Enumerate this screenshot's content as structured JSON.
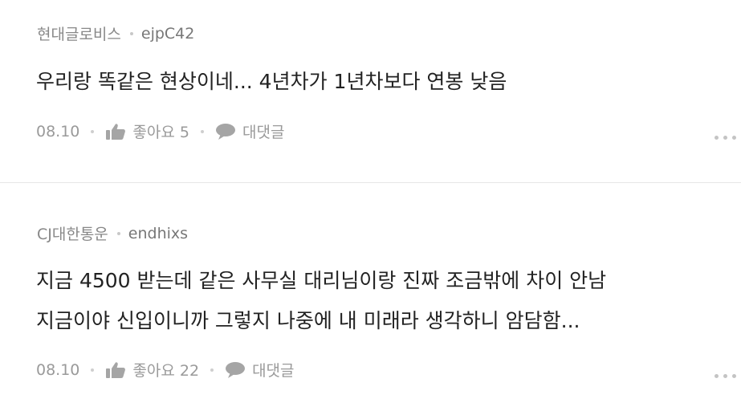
{
  "comments": [
    {
      "company": "현대글로비스",
      "user": "ejpC42",
      "lines": [
        "우리랑 똑같은 현상이네... 4년차가 1년차보다 연봉 낮음"
      ],
      "date": "08.10",
      "like_label": "좋아요 5",
      "reply_label": "대댓글"
    },
    {
      "company": "CJ대한통운",
      "user": "endhixs",
      "lines": [
        "지금 4500 받는데 같은 사무실 대리님이랑 진짜 조금밖에 차이 안남",
        "지금이야 신입이니까 그렇지 나중에 내 미래라 생각하니 암담함..."
      ],
      "date": "08.10",
      "like_label": "좋아요 22",
      "reply_label": "대댓글"
    }
  ],
  "icons": {
    "like": "thumbs-up-icon",
    "reply": "speech-bubble-icon",
    "more": "more-dots-icon"
  },
  "colors": {
    "text": "#222222",
    "meta": "#888888",
    "icon": "#a5a5a5",
    "divider": "#e6e6e6"
  }
}
